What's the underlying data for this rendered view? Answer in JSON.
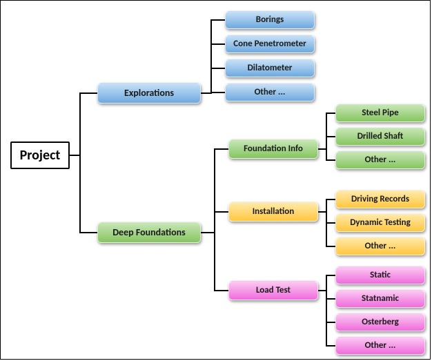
{
  "root": {
    "label": "Project"
  },
  "lvl2": {
    "explorations": {
      "label": "Explorations"
    },
    "deep_foundations": {
      "label": "Deep Foundations"
    }
  },
  "explorations_children": {
    "borings": "Borings",
    "cone": "Cone Penetrometer",
    "dilatometer": "Dilatometer",
    "other": "Other ..."
  },
  "df_children": {
    "foundation_info": {
      "label": "Foundation Info"
    },
    "installation": {
      "label": "Installation"
    },
    "load_test": {
      "label": "Load Test"
    }
  },
  "foundation_info_children": {
    "steel_pipe": "Steel Pipe",
    "drilled_shaft": "Drilled Shaft",
    "other": "Other ..."
  },
  "installation_children": {
    "driving_records": "Driving Records",
    "dynamic_testing": "Dynamic Testing",
    "other": "Other ..."
  },
  "load_test_children": {
    "static": "Static",
    "statnamic": "Statnamic",
    "osterberg": "Osterberg",
    "other": "Other ..."
  },
  "colors": {
    "blue": "#6ea9df",
    "green": "#86c55f",
    "yellow": "#ffc740",
    "pink": "#f06bdc"
  },
  "chart_data": {
    "type": "tree",
    "root": {
      "name": "Project",
      "children": [
        {
          "name": "Explorations",
          "color": "blue",
          "children": [
            {
              "name": "Borings",
              "color": "blue"
            },
            {
              "name": "Cone Penetrometer",
              "color": "blue"
            },
            {
              "name": "Dilatometer",
              "color": "blue"
            },
            {
              "name": "Other ...",
              "color": "blue"
            }
          ]
        },
        {
          "name": "Deep Foundations",
          "color": "green",
          "children": [
            {
              "name": "Foundation Info",
              "color": "green",
              "children": [
                {
                  "name": "Steel Pipe",
                  "color": "green"
                },
                {
                  "name": "Drilled Shaft",
                  "color": "green"
                },
                {
                  "name": "Other ...",
                  "color": "green"
                }
              ]
            },
            {
              "name": "Installation",
              "color": "yellow",
              "children": [
                {
                  "name": "Driving Records",
                  "color": "yellow"
                },
                {
                  "name": "Dynamic Testing",
                  "color": "yellow"
                },
                {
                  "name": "Other ...",
                  "color": "yellow"
                }
              ]
            },
            {
              "name": "Load Test",
              "color": "pink",
              "children": [
                {
                  "name": "Static",
                  "color": "pink"
                },
                {
                  "name": "Statnamic",
                  "color": "pink"
                },
                {
                  "name": "Osterberg",
                  "color": "pink"
                },
                {
                  "name": "Other ...",
                  "color": "pink"
                }
              ]
            }
          ]
        }
      ]
    }
  }
}
